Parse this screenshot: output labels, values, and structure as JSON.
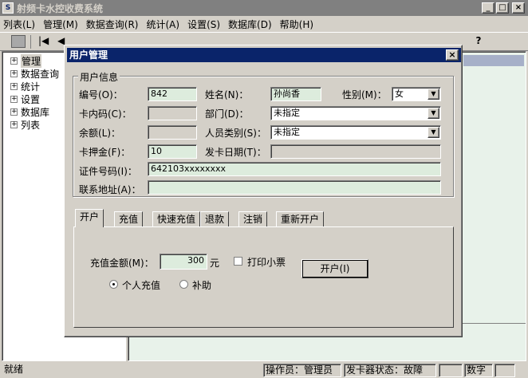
{
  "app": {
    "title": "射频卡水控收费系统",
    "min": "_",
    "max": "□",
    "close": "×"
  },
  "menu": [
    "列表(L)",
    "管理(M)",
    "数据查询(R)",
    "统计(A)",
    "设置(S)",
    "数据库(D)",
    "帮助(H)"
  ],
  "tree": [
    "管理",
    "数据查询",
    "统计",
    "设置",
    "数据库",
    "列表"
  ],
  "status": {
    "ready": "就绪",
    "operator": "操作员：管理员",
    "card_reader": "发卡器状态：故障",
    "num": "数字"
  },
  "dialog": {
    "title": "用户管理",
    "close": "×",
    "group_title": "用户信息",
    "labels": {
      "id": "编号(O)：",
      "name": "姓名(N)：",
      "gender": "性别(M)：",
      "card_code": "卡内码(C)：",
      "dept": "部门(D)：",
      "balance": "余额(L)：",
      "user_type": "人员类别(S)：",
      "deposit": "卡押金(F)：",
      "issue_date": "发卡日期(T)：",
      "id_number": "证件号码(I)：",
      "address": "联系地址(A)："
    },
    "values": {
      "id": "842",
      "name": "孙尚香",
      "gender": "女",
      "card_code": "",
      "dept": "未指定",
      "balance": "",
      "user_type": "未指定",
      "deposit": "10",
      "issue_date": "",
      "id_number": "642103xxxxxxxx",
      "address": ""
    },
    "tabs": [
      "开户",
      "充值",
      "快速充值",
      "退款",
      "注销",
      "重新开户"
    ],
    "panel": {
      "amount_label": "充值金额(M)：",
      "amount": "300",
      "unit": "元",
      "print_label": "打印小票",
      "open_button": "开户(I)",
      "radio_personal": "个人充值",
      "radio_subsidy": "补助"
    }
  }
}
